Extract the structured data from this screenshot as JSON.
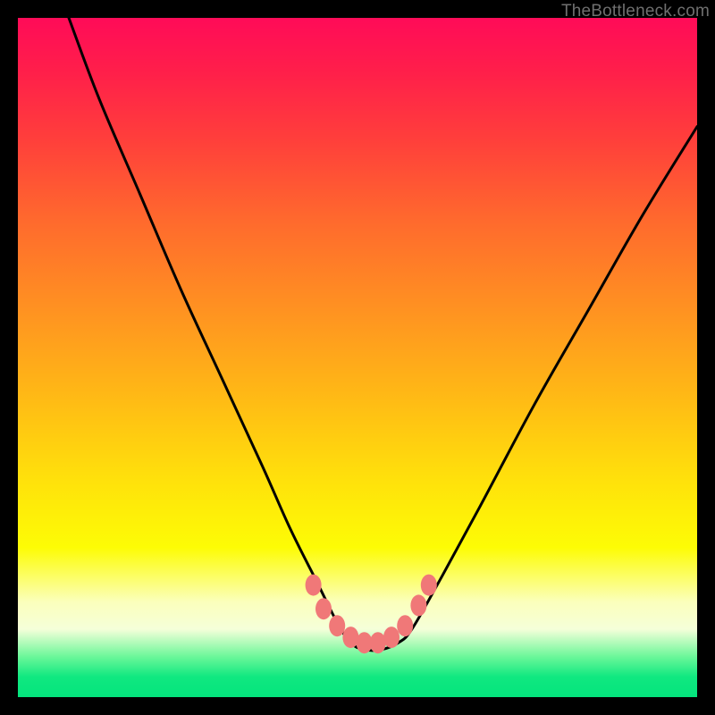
{
  "watermark": "TheBottleneck.com",
  "chart_data": {
    "type": "line",
    "title": "",
    "xlabel": "",
    "ylabel": "",
    "xlim": [
      0,
      100
    ],
    "ylim": [
      0,
      100
    ],
    "series": [
      {
        "name": "curve",
        "x": [
          7.5,
          12,
          18,
          24,
          30,
          36,
          40,
          44,
          47,
          49,
          51,
          53.5,
          56,
          58,
          62,
          68,
          76,
          84,
          92,
          100
        ],
        "values": [
          100,
          88,
          74,
          60,
          47,
          34,
          25,
          17,
          11,
          8,
          7,
          7,
          8,
          10,
          17,
          28,
          43,
          57,
          71,
          84
        ]
      }
    ],
    "markers": [
      {
        "x": 43.5,
        "y": 16.5
      },
      {
        "x": 45.0,
        "y": 13.0
      },
      {
        "x": 47.0,
        "y": 10.5
      },
      {
        "x": 49.0,
        "y": 8.8
      },
      {
        "x": 51.0,
        "y": 8.0
      },
      {
        "x": 53.0,
        "y": 8.0
      },
      {
        "x": 55.0,
        "y": 8.8
      },
      {
        "x": 57.0,
        "y": 10.5
      },
      {
        "x": 59.0,
        "y": 13.5
      },
      {
        "x": 60.5,
        "y": 16.5
      }
    ],
    "gradient_stops": [
      {
        "pos": 0,
        "color": "#ff0b58"
      },
      {
        "pos": 18,
        "color": "#ff3f3b"
      },
      {
        "pos": 42,
        "color": "#ff8f22"
      },
      {
        "pos": 68,
        "color": "#ffe10b"
      },
      {
        "pos": 86,
        "color": "#fbffbc"
      },
      {
        "pos": 94,
        "color": "#6df79a"
      },
      {
        "pos": 100,
        "color": "#04e47d"
      }
    ]
  }
}
